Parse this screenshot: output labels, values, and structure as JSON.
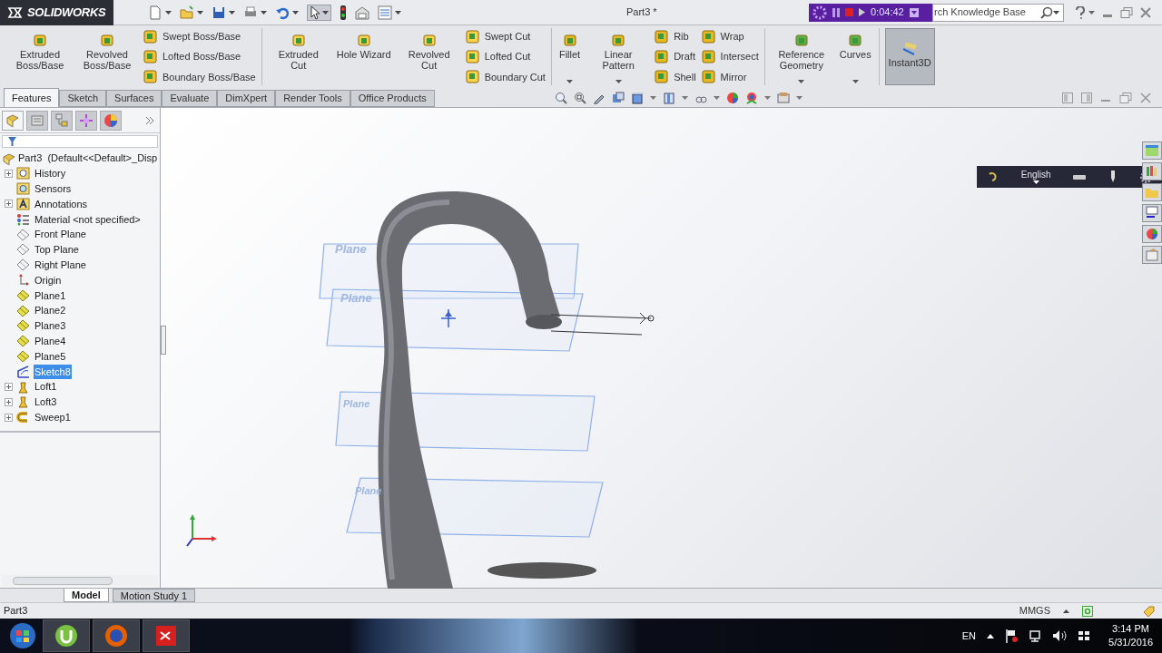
{
  "title_bar": {
    "logo": "SOLIDWORKS",
    "title": "Part3 *",
    "recorder_time": "0:04:42",
    "search": {
      "placeholder": "rch Knowledge Base"
    }
  },
  "ribbon": {
    "groups": [
      {
        "items": [
          {
            "kind": "large",
            "label": "Extruded Boss/Base",
            "dropdown": false
          },
          {
            "kind": "large",
            "label": "Revolved Boss/Base",
            "dropdown": false
          },
          {
            "kind": "column",
            "entries": [
              "Swept Boss/Base",
              "Lofted Boss/Base",
              "Boundary Boss/Base"
            ]
          }
        ]
      },
      {
        "items": [
          {
            "kind": "large",
            "label": "Extruded Cut",
            "dropdown": false
          },
          {
            "kind": "large",
            "label": "Hole Wizard",
            "dropdown": false
          },
          {
            "kind": "large",
            "label": "Revolved Cut",
            "dropdown": false
          },
          {
            "kind": "column",
            "entries": [
              "Swept Cut",
              "Lofted Cut",
              "Boundary Cut"
            ]
          }
        ]
      },
      {
        "items": [
          {
            "kind": "large",
            "label": "Fillet",
            "dropdown": true
          },
          {
            "kind": "large",
            "label": "Linear Pattern",
            "dropdown": true
          },
          {
            "kind": "column",
            "entries": [
              "Rib",
              "Draft",
              "Shell"
            ]
          },
          {
            "kind": "column",
            "entries": [
              "Wrap",
              "Intersect",
              "Mirror"
            ]
          }
        ]
      },
      {
        "items": [
          {
            "kind": "large",
            "label": "Reference Geometry",
            "dropdown": true
          },
          {
            "kind": "large",
            "label": "Curves",
            "dropdown": true
          }
        ]
      },
      {
        "items": [
          {
            "kind": "toggle",
            "label": "Instant3D",
            "selected": true
          }
        ]
      }
    ]
  },
  "tabs": [
    {
      "label": "Features",
      "selected": true
    },
    {
      "label": "Sketch",
      "selected": false
    },
    {
      "label": "Surfaces",
      "selected": false
    },
    {
      "label": "Evaluate",
      "selected": false
    },
    {
      "label": "DimXpert",
      "selected": false
    },
    {
      "label": "Render Tools",
      "selected": false
    },
    {
      "label": "Office Products",
      "selected": false
    }
  ],
  "panel_tabs": [
    {
      "selected": true
    },
    {
      "selected": false
    },
    {
      "selected": false
    },
    {
      "selected": false
    },
    {
      "selected": false
    }
  ],
  "feature_tree": {
    "root": "Part3  (Default<<Default>_Disp",
    "items": [
      {
        "label": "History",
        "kind": "history",
        "expandable": true,
        "selected": false
      },
      {
        "label": "Sensors",
        "kind": "sensor",
        "expandable": false,
        "selected": false
      },
      {
        "label": "Annotations",
        "kind": "annotations",
        "expandable": true,
        "selected": false
      },
      {
        "label": "Material <not specified>",
        "kind": "material",
        "expandable": false,
        "selected": false
      },
      {
        "label": "Front Plane",
        "kind": "std-plane",
        "expandable": false,
        "selected": false
      },
      {
        "label": "Top Plane",
        "kind": "std-plane",
        "expandable": false,
        "selected": false
      },
      {
        "label": "Right Plane",
        "kind": "std-plane",
        "expandable": false,
        "selected": false
      },
      {
        "label": "Origin",
        "kind": "origin",
        "expandable": false,
        "selected": false
      },
      {
        "label": "Plane1",
        "kind": "plane",
        "expandable": false,
        "selected": false
      },
      {
        "label": "Plane2",
        "kind": "plane",
        "expandable": false,
        "selected": false
      },
      {
        "label": "Plane3",
        "kind": "plane",
        "expandable": false,
        "selected": false
      },
      {
        "label": "Plane4",
        "kind": "plane",
        "expandable": false,
        "selected": false
      },
      {
        "label": "Plane5",
        "kind": "plane",
        "expandable": false,
        "selected": false
      },
      {
        "label": "Sketch8",
        "kind": "sketch",
        "expandable": false,
        "selected": true
      },
      {
        "label": "Loft1",
        "kind": "loft",
        "expandable": true,
        "selected": false
      },
      {
        "label": "Loft3",
        "kind": "loft",
        "expandable": true,
        "selected": false
      },
      {
        "label": "Sweep1",
        "kind": "sweep",
        "expandable": true,
        "selected": false
      }
    ]
  },
  "viewport": {
    "plane_labels": [
      "Plane",
      "Plane",
      "Plane",
      "Plane"
    ],
    "language_bar": "English"
  },
  "bottom_tabs": [
    {
      "label": "Model",
      "selected": true
    },
    {
      "label": "Motion Study 1",
      "selected": false
    }
  ],
  "status_bar": {
    "document": "Part3",
    "units": "MMGS"
  },
  "taskbar": {
    "language": "EN",
    "time": "3:14 PM",
    "date": "5/31/2016"
  }
}
